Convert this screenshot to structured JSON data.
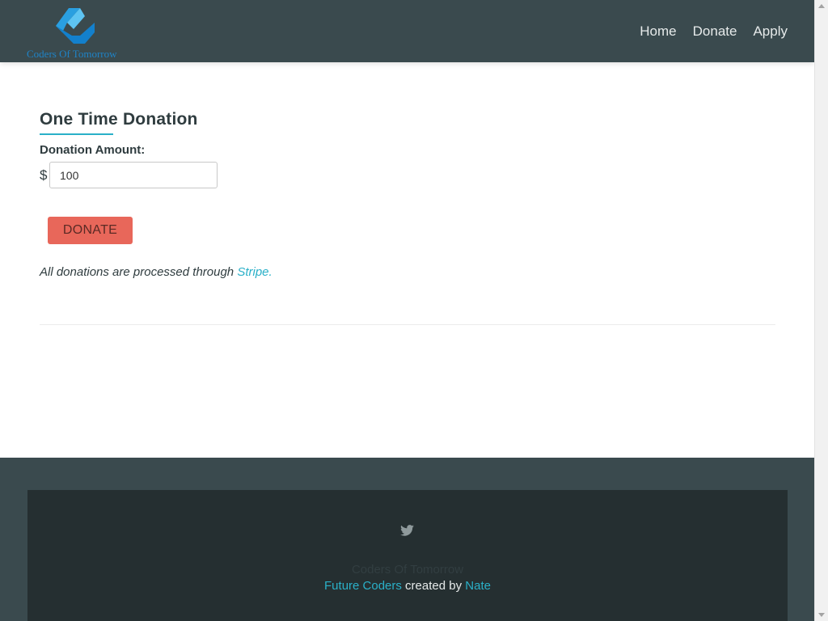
{
  "header": {
    "logo_text": "Coders Of Tomorrow",
    "nav": [
      {
        "label": "Home"
      },
      {
        "label": "Donate"
      },
      {
        "label": "Apply"
      }
    ]
  },
  "donation": {
    "title": "One Time Donation",
    "amount_label": "Donation Amount:",
    "currency_symbol": "$",
    "amount_value": "100",
    "button_label": "DONATE",
    "note_text": "All donations are processed through ",
    "note_link": "Stripe."
  },
  "footer": {
    "icon": "twitter-icon",
    "brand": "Coders Of Tomorrow",
    "credit_link": "Future Coders",
    "credit_middle": " created by ",
    "credit_author": "Nate"
  },
  "colors": {
    "header_bg": "#3a4a4e",
    "accent": "#2ab0c8",
    "donate_button": "#e8675a",
    "footer_inner": "#252f31",
    "logo_blue": "#1f83c6"
  }
}
